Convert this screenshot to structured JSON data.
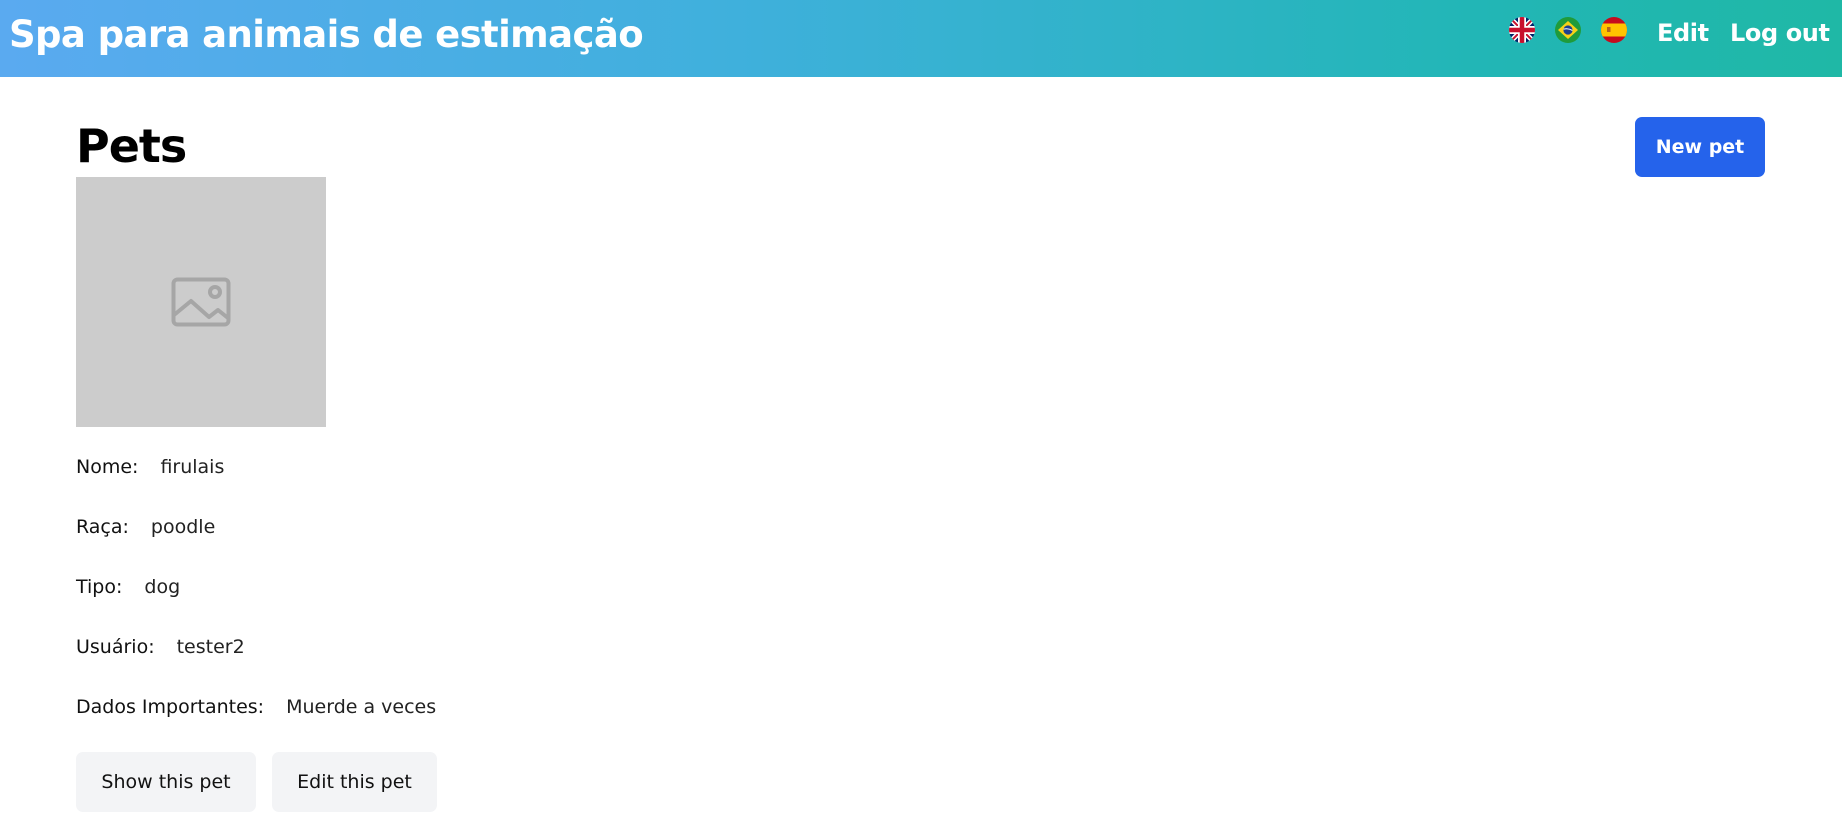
{
  "header": {
    "brand": "Spa para animais de estimação",
    "languages": [
      {
        "code": "en",
        "icon": "uk-flag-icon"
      },
      {
        "code": "pt-BR",
        "icon": "brazil-flag-icon"
      },
      {
        "code": "es",
        "icon": "spain-flag-icon"
      }
    ],
    "edit_label": "Edit",
    "logout_label": "Log out"
  },
  "main": {
    "title": "Pets",
    "new_pet_label": "New pet",
    "pet": {
      "photo_icon": "image-placeholder-icon",
      "fields": [
        {
          "label": "Nome:",
          "value": "firulais"
        },
        {
          "label": "Raça:",
          "value": "poodle"
        },
        {
          "label": "Tipo:",
          "value": "dog"
        },
        {
          "label": "Usuário:",
          "value": "tester2"
        },
        {
          "label": "Dados Importantes:",
          "value": "Muerde a veces"
        }
      ],
      "show_label": "Show this pet",
      "edit_label": "Edit this pet"
    }
  },
  "colors": {
    "header_gradient_start": "#5aaaf0",
    "header_gradient_end": "#1fb8a6",
    "primary_button": "#2563eb",
    "secondary_button": "#f3f4f6",
    "photo_placeholder": "#cccccc"
  }
}
